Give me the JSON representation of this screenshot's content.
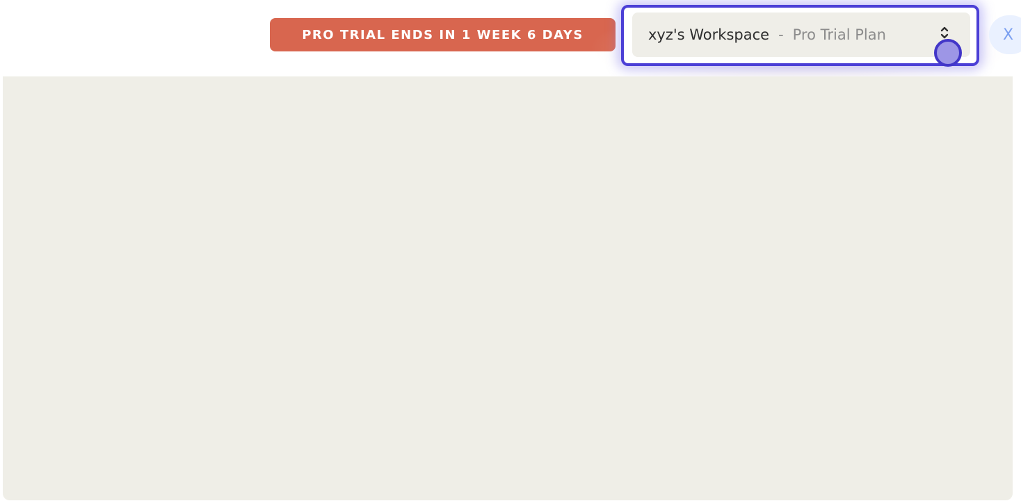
{
  "header": {
    "trial_badge": "PRO TRIAL ENDS IN 1 WEEK 6 DAYS",
    "workspace": {
      "name": "xyz's Workspace",
      "separator": "-",
      "plan": "Pro Trial Plan",
      "icon": "chevron-up-down-icon"
    },
    "next_button_label": "X"
  },
  "colors": {
    "trial_badge_bg": "#d8664f",
    "highlight_border": "#4b3fd6",
    "workspace_bg": "#efeee8",
    "content_bg": "#efeee7"
  }
}
